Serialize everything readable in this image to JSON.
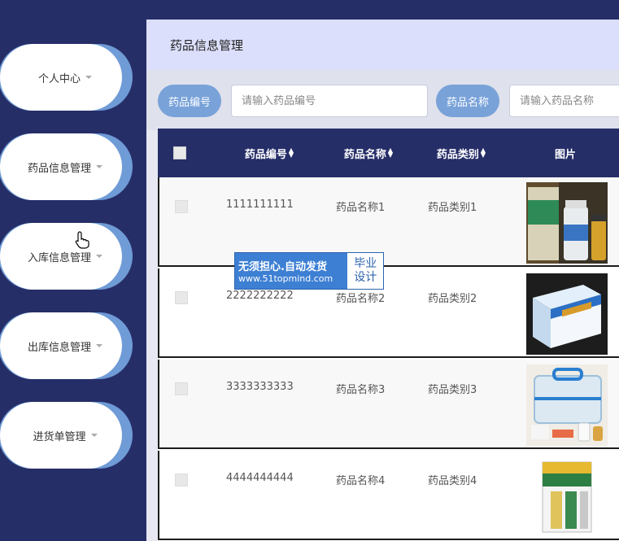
{
  "sidebar": {
    "items": [
      {
        "label": "个人中心"
      },
      {
        "label": "药品信息管理"
      },
      {
        "label": "入库信息管理"
      },
      {
        "label": "出库信息管理"
      },
      {
        "label": "进货单管理"
      }
    ]
  },
  "header": {
    "title": "药品信息管理"
  },
  "search": {
    "code_label": "药品编号",
    "code_placeholder": "请输入药品编号",
    "name_label": "药品名称",
    "name_placeholder": "请输入药品名称"
  },
  "table": {
    "columns": [
      "药品编号",
      "药品名称",
      "药品类别",
      "图片"
    ],
    "rows": [
      {
        "code": "1111111111",
        "name": "药品名称1",
        "category": "药品类别1",
        "image": "medicine-bottle-photo"
      },
      {
        "code": "2222222222",
        "name": "药品名称2",
        "category": "药品类别2",
        "image": "medicine-box-photo"
      },
      {
        "code": "3333333333",
        "name": "药品名称3",
        "category": "药品类别3",
        "image": "first-aid-kit-photo"
      },
      {
        "code": "4444444444",
        "name": "药品名称4",
        "category": "药品类别4",
        "image": "tablet-box-photo"
      }
    ]
  },
  "watermark": {
    "line1": "无须担心.自动发货",
    "line2": "www.51topmind.com",
    "side_line1": "毕业",
    "side_line2": "设计"
  },
  "colors": {
    "sidebar_bg": "#262e68",
    "accent": "#79a2d9",
    "table_header": "#262e68"
  }
}
